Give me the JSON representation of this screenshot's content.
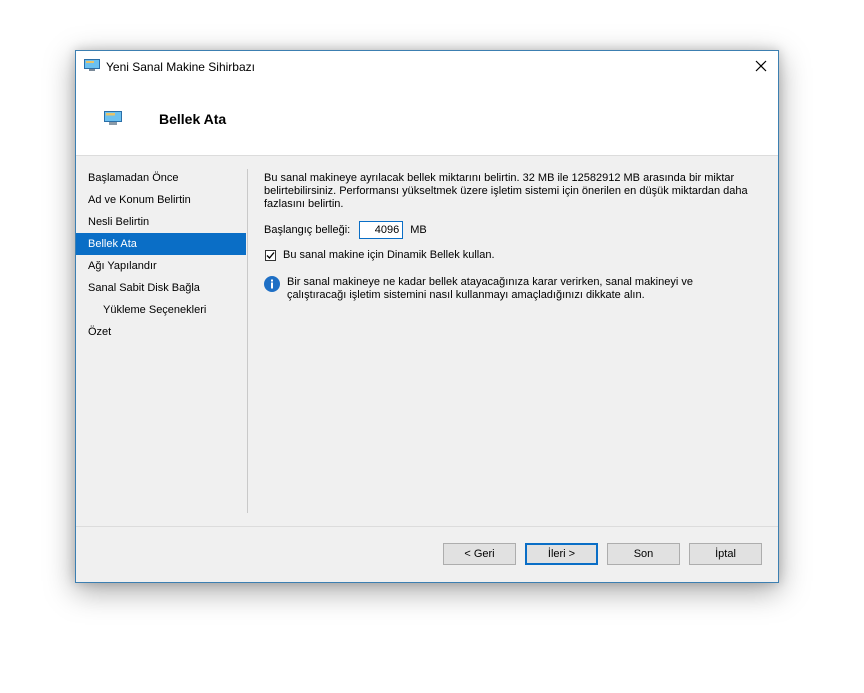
{
  "window": {
    "title": "Yeni Sanal Makine Sihirbazı"
  },
  "header": {
    "title": "Bellek Ata"
  },
  "nav": {
    "items": [
      {
        "label": "Başlamadan Önce"
      },
      {
        "label": "Ad ve Konum Belirtin"
      },
      {
        "label": "Nesli Belirtin"
      },
      {
        "label": "Bellek Ata",
        "active": true
      },
      {
        "label": "Ağı Yapılandır"
      },
      {
        "label": "Sanal Sabit Disk Bağla"
      },
      {
        "label": "Yükleme Seçenekleri",
        "sub": true
      },
      {
        "label": "Özet"
      }
    ]
  },
  "content": {
    "description": "Bu sanal makineye ayrılacak bellek miktarını belirtin. 32 MB ile 12582912 MB arasında bir miktar belirtebilirsiniz. Performansı yükseltmek üzere işletim sistemi için önerilen en düşük miktardan daha fazlasını belirtin.",
    "startup_memory_label": "Başlangıç belleği:",
    "startup_memory_value": "4096",
    "startup_memory_unit": "MB",
    "dynamic_memory_label": "Bu sanal makine için Dinamik Bellek kullan.",
    "dynamic_memory_checked": true,
    "info_text": "Bir sanal makineye ne kadar bellek atayacağınıza karar verirken, sanal makineyi ve çalıştıracağı işletim sistemini nasıl kullanmayı amaçladığınızı dikkate alın."
  },
  "buttons": {
    "back": "< Geri",
    "next": "İleri >",
    "finish": "Son",
    "cancel": "İptal"
  },
  "colors": {
    "accent": "#0a6ec6",
    "window_border": "#3c7fb1",
    "info_icon": "#1e6fc5"
  }
}
